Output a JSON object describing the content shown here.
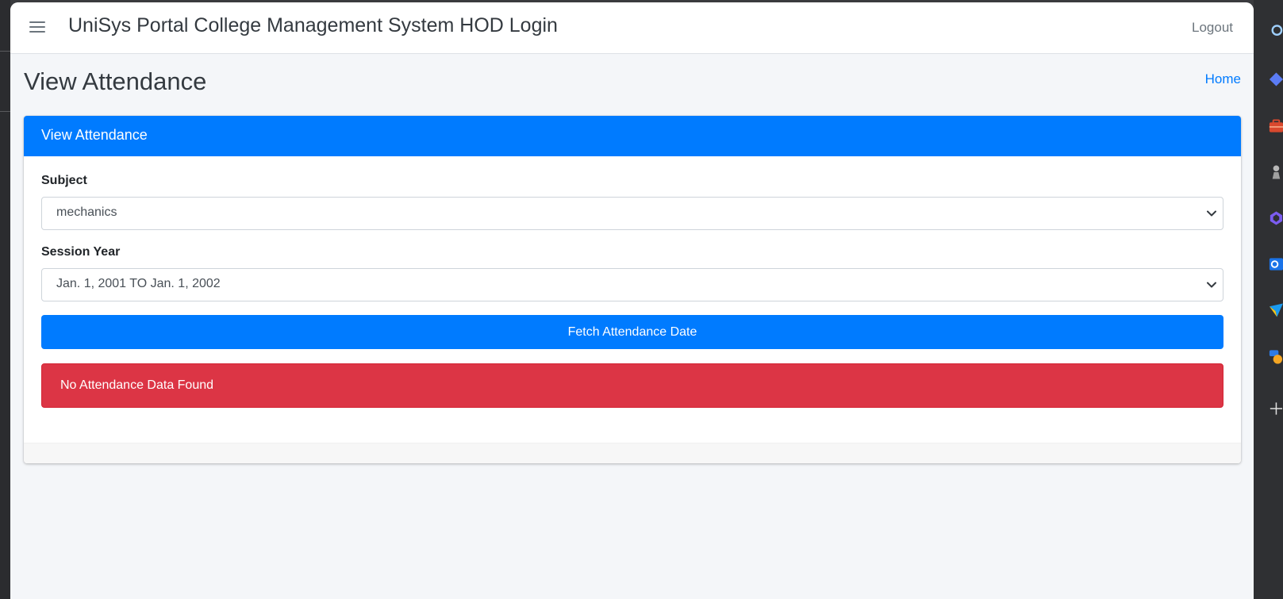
{
  "navbar": {
    "brand": "UniSys Portal College Management System HOD Login",
    "logout_label": "Logout"
  },
  "header": {
    "page_title": "View Attendance",
    "breadcrumb_home": "Home"
  },
  "card": {
    "title": "View Attendance",
    "subject": {
      "label": "Subject",
      "selected": "mechanics"
    },
    "session_year": {
      "label": "Session Year",
      "selected": "Jan. 1, 2001 TO Jan. 1, 2002"
    },
    "fetch_button_label": "Fetch Attendance Date",
    "alert_text": "No Attendance Data Found"
  },
  "sidebar_icons": [
    "search-icon",
    "diamond-icon",
    "toolbox-icon",
    "chess-icon",
    "copilot-icon",
    "outlook-icon",
    "send-icon",
    "games-icon",
    "add-icon"
  ],
  "colors": {
    "primary": "#007bff",
    "danger": "#dc3545",
    "background": "#f4f6f9"
  }
}
